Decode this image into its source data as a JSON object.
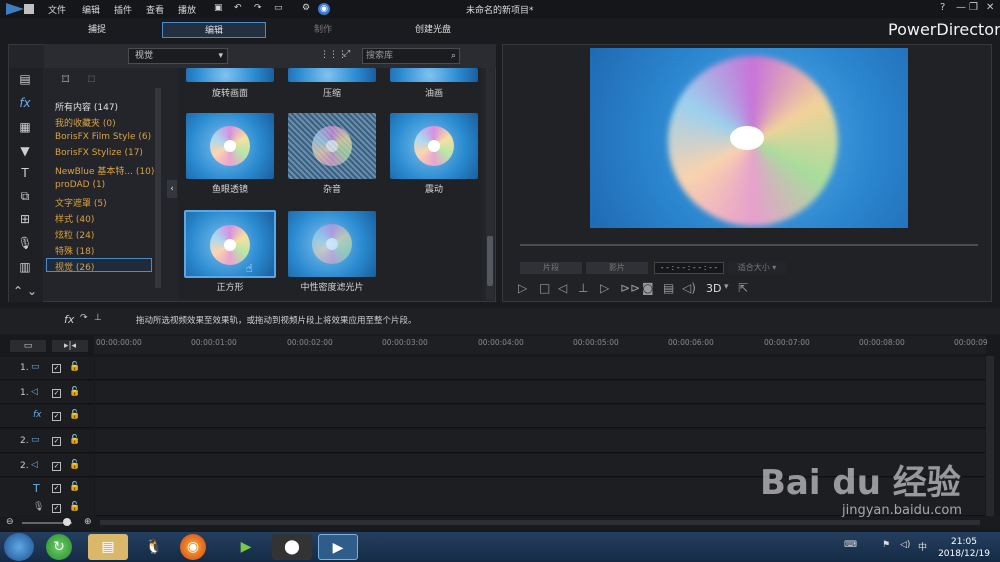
{
  "app": {
    "title": "未命名的新项目*",
    "brand": "PowerDirector"
  },
  "menu": [
    "文件",
    "编辑",
    "插件",
    "查看",
    "播放"
  ],
  "modes": [
    "捕捉",
    "编辑",
    "制作",
    "创建光盘"
  ],
  "filter": {
    "dropdown": "视觉",
    "search_placeholder": "搜索库"
  },
  "categories": [
    "所有内容 (147)",
    "我的收藏夹 (0)",
    "BorisFX Film Style (6)",
    "BorisFX Stylize (17)",
    "NewBlue 基本特... (10)",
    "proDAD (1)",
    "文字遮罩 (5)",
    "样式 (40)",
    "炫粒 (24)",
    "特殊 (18)",
    "视觉 (26)"
  ],
  "effects_top": [
    "旋转画面",
    "压缩",
    "油画"
  ],
  "effects": [
    "鱼眼透镜",
    "杂音",
    "震动",
    "正方形",
    "中性密度滤光片"
  ],
  "preview": {
    "btn_clip": "片段",
    "btn_movie": "影片",
    "timecode": "- - : - - : - - : - -",
    "ratio": "适合大小",
    "mode3d": "3D"
  },
  "hint": "拖动所选视频效果至效果轨，或拖动到视频片段上将效果应用至整个片段。",
  "ruler": [
    "00:00:00:00",
    "00:00:01:00",
    "00:00:02:00",
    "00:00:03:00",
    "00:00:04:00",
    "00:00:05:00",
    "00:00:06:00",
    "00:00:07:00",
    "00:00:08:00",
    "00:00:09"
  ],
  "tracks": [
    {
      "num": "1.",
      "icon": "video-icon"
    },
    {
      "num": "1.",
      "icon": "audio-icon"
    },
    {
      "num": "",
      "icon": "fx-icon"
    },
    {
      "num": "2.",
      "icon": "video-icon"
    },
    {
      "num": "2.",
      "icon": "audio-icon"
    },
    {
      "num": "",
      "icon": "title-icon"
    },
    {
      "num": "",
      "icon": "mic-icon"
    }
  ],
  "clock": {
    "time": "21:05",
    "date": "2018/12/19"
  },
  "watermark": {
    "logo": "Bai du 经验",
    "url": "jingyan.baidu.com"
  }
}
